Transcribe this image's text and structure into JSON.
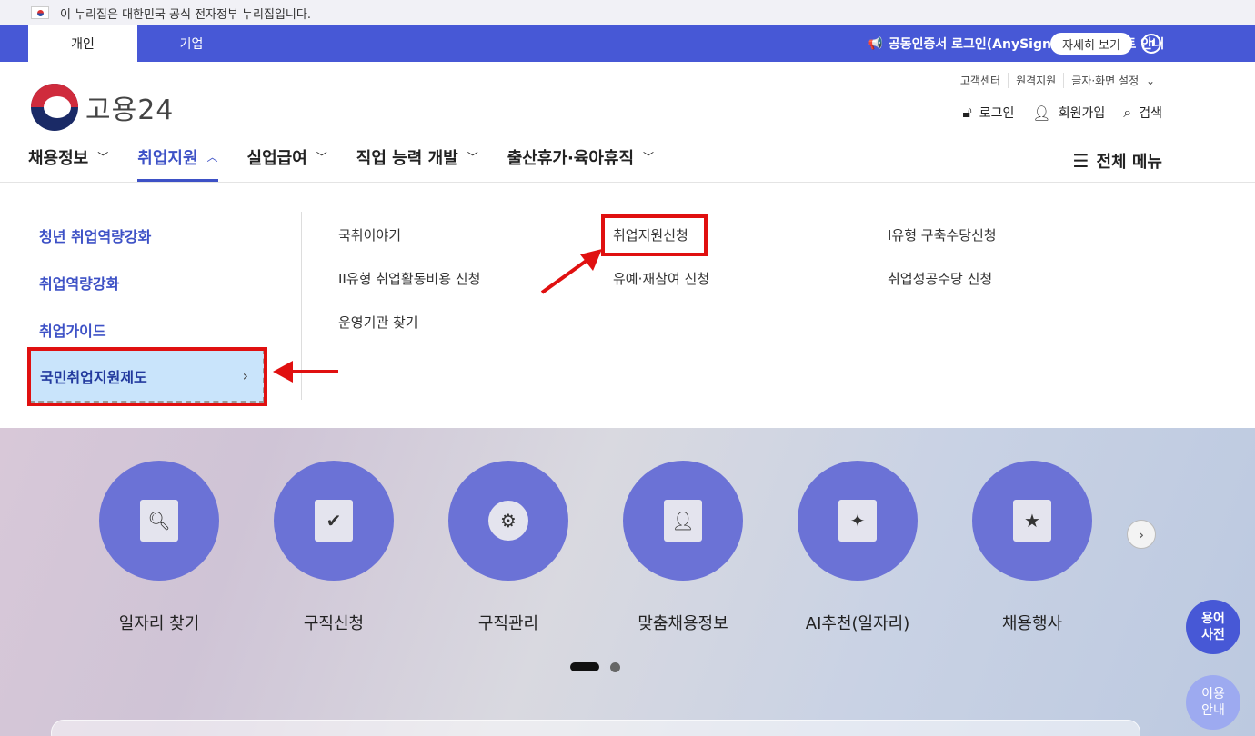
{
  "gov_notice": {
    "text": "이 누리집은 대한민국 공식 전자정부 누리집입니다."
  },
  "top_band": {
    "tabs": [
      {
        "label": "개인"
      },
      {
        "label": "기업"
      }
    ],
    "notice": "공동인증서 로그인(AnySign) 버전 업데이트 안내",
    "detail_button": "자세히 보기"
  },
  "header": {
    "logo_text": "고용24",
    "util_links": [
      "고객센터",
      "원격지원",
      "글자·화면 설정"
    ],
    "user_links": {
      "login": "로그인",
      "signup": "회원가입",
      "search": "검색"
    }
  },
  "gnb": {
    "items": [
      {
        "label": "채용정보"
      },
      {
        "label": "취업지원"
      },
      {
        "label": "실업급여"
      },
      {
        "label": "직업 능력 개발"
      },
      {
        "label": "출산휴가·육아휴직"
      }
    ],
    "all_menu": "전체 메뉴"
  },
  "dropdown": {
    "side": [
      "청년 취업역량강화",
      "취업역량강화",
      "취업가이드",
      "국민취업지원제도"
    ],
    "sub_col1": [
      "국취이야기",
      "II유형 취업활동비용 신청",
      "운영기관 찾기"
    ],
    "sub_col2": [
      "취업지원신청",
      "유예·재참여 신청"
    ],
    "sub_col3": [
      "I유형 구축수당신청",
      "취업성공수당 신청"
    ]
  },
  "quick_menu": [
    {
      "label": "일자리 찾기",
      "icon": "document-search-icon"
    },
    {
      "label": "구직신청",
      "icon": "document-check-icon"
    },
    {
      "label": "구직관리",
      "icon": "gear-briefcase-icon"
    },
    {
      "label": "맞춤채용정보",
      "icon": "puzzle-person-icon"
    },
    {
      "label": "AI추천(일자리)",
      "icon": "magic-wand-icon"
    },
    {
      "label": "채용행사",
      "icon": "calendar-star-icon"
    }
  ],
  "floating": {
    "dictionary": "용어\n사전",
    "guide": "이용\n안내"
  },
  "colors": {
    "primary": "#4758d6",
    "active_nav": "#3d51c6",
    "quick_circle": "#6b72d6",
    "highlight": "#e01010"
  }
}
